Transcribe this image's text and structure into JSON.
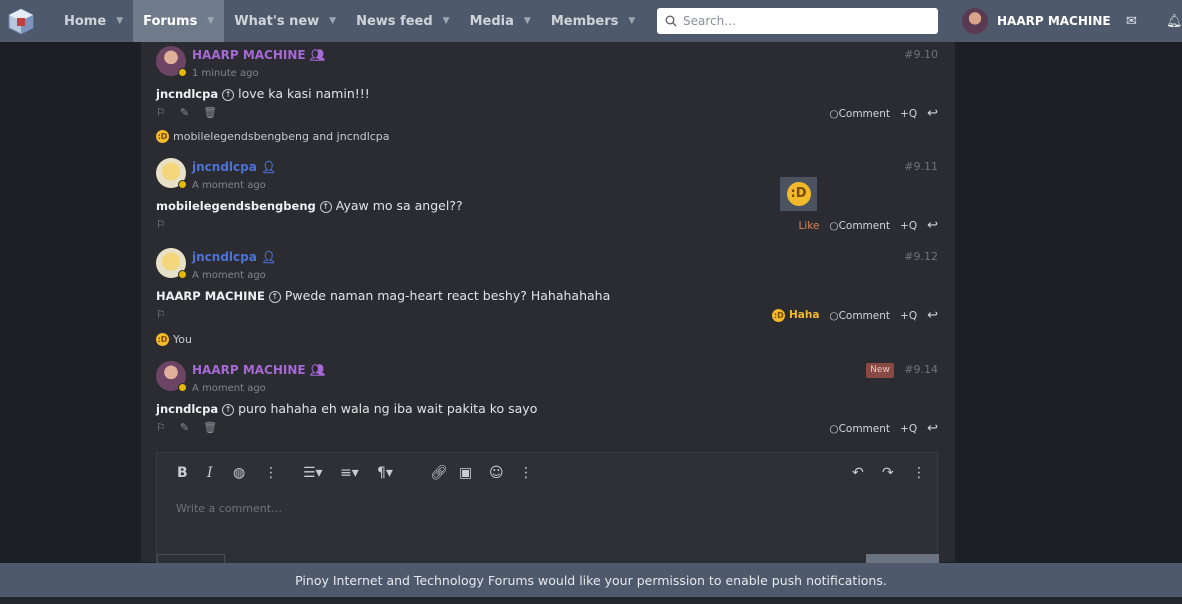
{
  "nav": {
    "tabs": [
      {
        "label": "Home"
      },
      {
        "label": "Forums"
      },
      {
        "label": "What's new"
      },
      {
        "label": "News feed"
      },
      {
        "label": "Media"
      },
      {
        "label": "Members"
      }
    ],
    "search_placeholder": "Search…",
    "username": "HAARP MACHINE"
  },
  "posts": [
    {
      "author": "HAARP MACHINE",
      "time": "1 minute ago",
      "number": "#9.10",
      "reply_to": "jncndlcpa",
      "text": "love ka kasi namin!!!",
      "reactions": "mobilelegendsbengbeng and jncndlcpa"
    },
    {
      "author": "jncndlcpa",
      "time": "A moment ago",
      "number": "#9.11",
      "reply_to": "mobilelegendsbengbeng",
      "text": "Ayaw mo sa angel??",
      "like_label": "Like"
    },
    {
      "author": "jncndlcpa",
      "time": "A moment ago",
      "number": "#9.12",
      "reply_to": "HAARP MACHINE",
      "text": "Pwede naman mag-heart react beshy? Hahahahaha",
      "reaction_label": "Haha",
      "reactions": "You"
    },
    {
      "author": "HAARP MACHINE",
      "time": "A moment ago",
      "number": "#9.14",
      "badge": "New",
      "reply_to": "jncndlcpa",
      "text": "puro hahaha eh wala ng iba wait pakita ko sayo"
    }
  ],
  "actions": {
    "comment": "Comment",
    "quote": "+Q"
  },
  "editor": {
    "placeholder": "Write a comment…"
  },
  "notification": "Pinoy Internet and Technology Forums would like your permission to enable push notifications.",
  "colors": {
    "nav_bg": "#4e5a6b",
    "haarp_name": "#a56ad4",
    "jnc_name": "#4d72d8",
    "haha": "#f2b92b"
  }
}
